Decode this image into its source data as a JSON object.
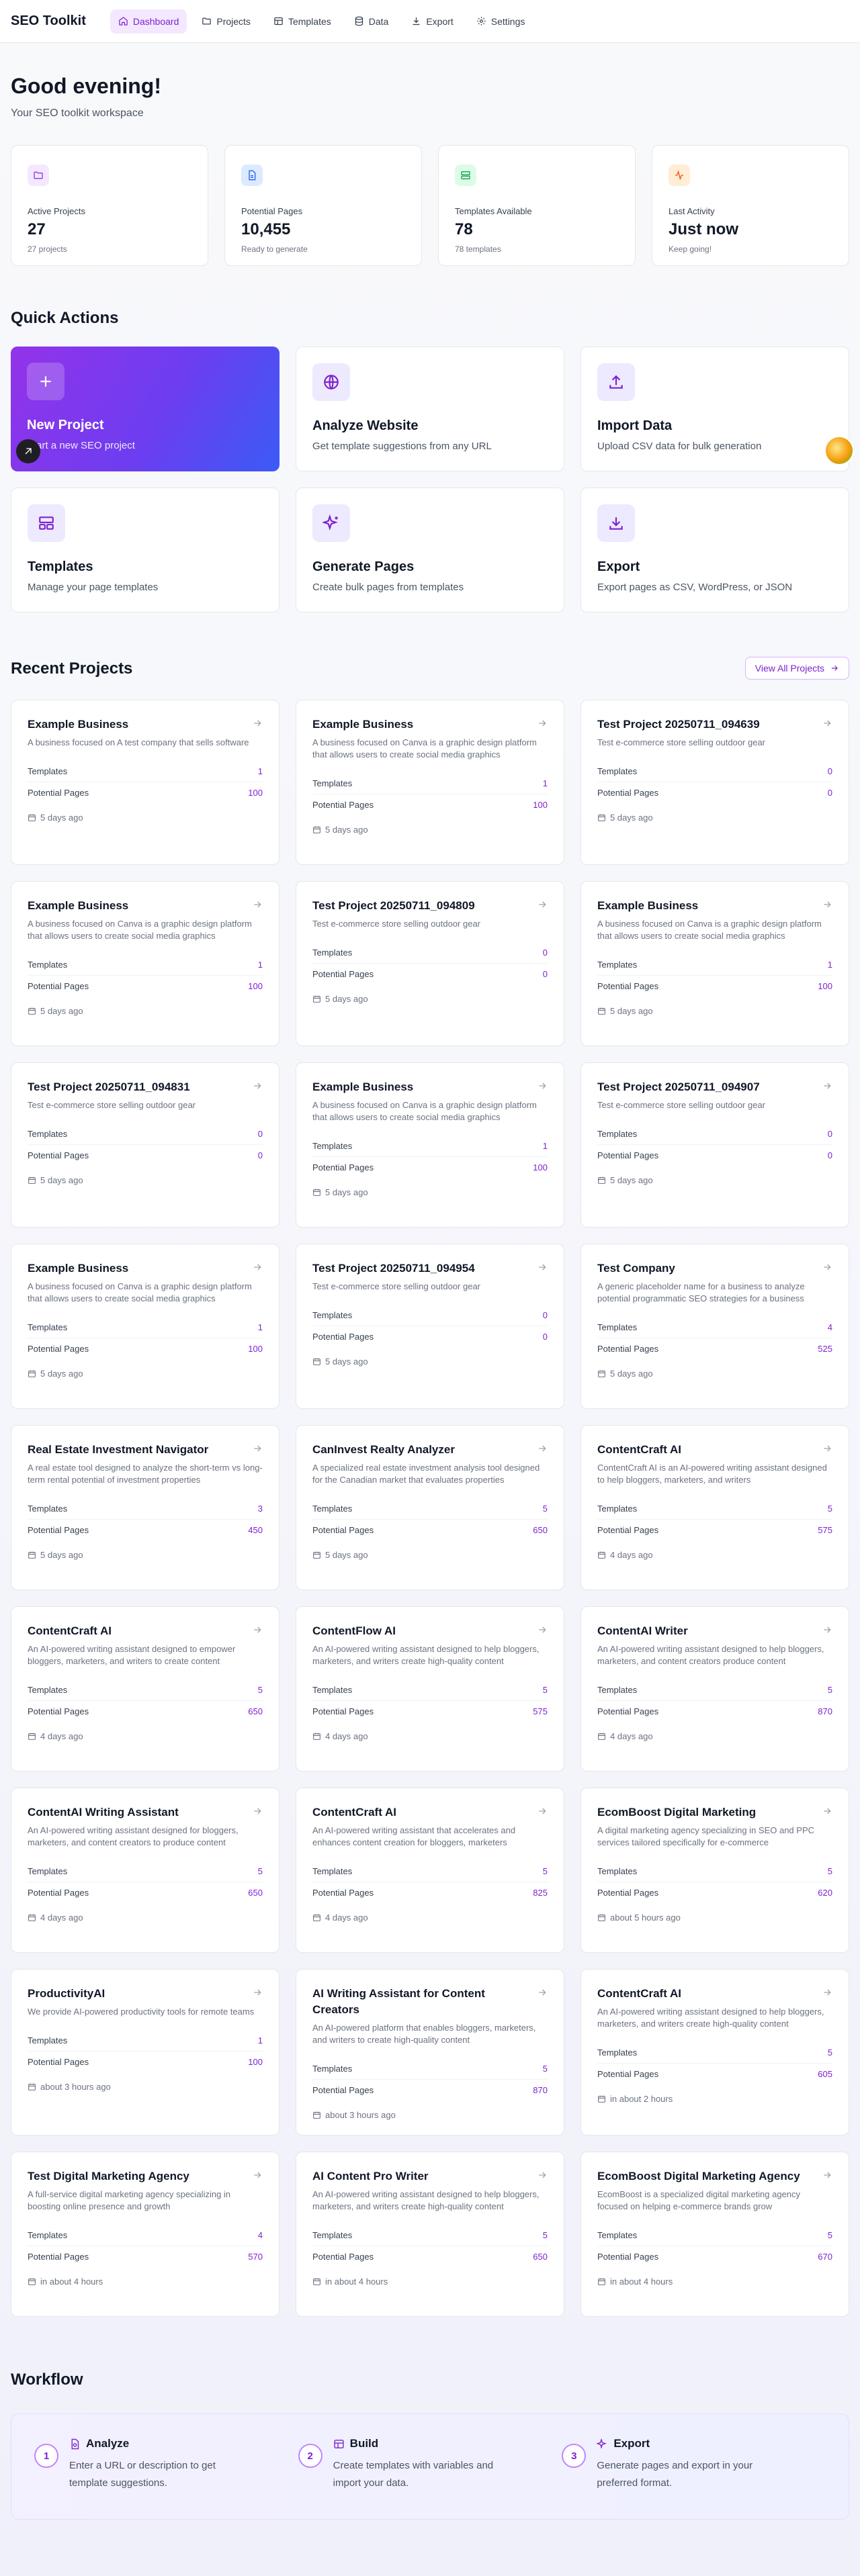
{
  "header": {
    "brand": "SEO Toolkit",
    "nav": [
      {
        "label": "Dashboard",
        "icon": "home-icon"
      },
      {
        "label": "Projects",
        "icon": "folder-icon"
      },
      {
        "label": "Templates",
        "icon": "layout-icon"
      },
      {
        "label": "Data",
        "icon": "database-icon"
      },
      {
        "label": "Export",
        "icon": "download-icon"
      },
      {
        "label": "Settings",
        "icon": "gear-icon"
      }
    ]
  },
  "greeting": {
    "title": "Good evening!",
    "subtitle": "Your SEO toolkit workspace"
  },
  "stats": [
    {
      "label": "Active Projects",
      "value": "27",
      "sub": "27 projects",
      "icon": "folder-icon",
      "color": "#9333ea"
    },
    {
      "label": "Potential Pages",
      "value": "10,455",
      "sub": "Ready to generate",
      "icon": "file-icon",
      "color": "#2563eb"
    },
    {
      "label": "Templates Available",
      "value": "78",
      "sub": "78 templates",
      "icon": "layout-icon",
      "color": "#16a34a"
    },
    {
      "label": "Last Activity",
      "value": "Just now",
      "sub": "Keep going!",
      "icon": "activity-icon",
      "color": "#ea580c"
    }
  ],
  "quick_actions": {
    "title": "Quick Actions",
    "items": [
      {
        "title": "New Project",
        "desc": "Start a new SEO project",
        "icon": "plus-icon"
      },
      {
        "title": "Analyze Website",
        "desc": "Get template suggestions from any URL",
        "icon": "globe-icon"
      },
      {
        "title": "Import Data",
        "desc": "Upload CSV data for bulk generation",
        "icon": "upload-icon"
      },
      {
        "title": "Templates",
        "desc": "Manage your page templates",
        "icon": "layout-icon"
      },
      {
        "title": "Generate Pages",
        "desc": "Create bulk pages from templates",
        "icon": "sparkles-icon"
      },
      {
        "title": "Export",
        "desc": "Export pages as CSV, WordPress, or JSON",
        "icon": "download-icon"
      }
    ]
  },
  "recent": {
    "title": "Recent Projects",
    "view_all": "View All Projects",
    "templates_label": "Templates",
    "pages_label": "Potential Pages",
    "projects": [
      {
        "name": "Example Business",
        "desc": "A business focused on A test company that sells software",
        "templates": "1",
        "pages": "100",
        "time": "5 days ago"
      },
      {
        "name": "Example Business",
        "desc": "A business focused on Canva is a graphic design platform that allows users to create social media graphics",
        "templates": "1",
        "pages": "100",
        "time": "5 days ago"
      },
      {
        "name": "Test Project 20250711_094639",
        "desc": "Test e-commerce store selling outdoor gear",
        "templates": "0",
        "pages": "0",
        "time": "5 days ago"
      },
      {
        "name": "Example Business",
        "desc": "A business focused on Canva is a graphic design platform that allows users to create social media graphics",
        "templates": "1",
        "pages": "100",
        "time": "5 days ago"
      },
      {
        "name": "Test Project 20250711_094809",
        "desc": "Test e-commerce store selling outdoor gear",
        "templates": "0",
        "pages": "0",
        "time": "5 days ago"
      },
      {
        "name": "Example Business",
        "desc": "A business focused on Canva is a graphic design platform that allows users to create social media graphics",
        "templates": "1",
        "pages": "100",
        "time": "5 days ago"
      },
      {
        "name": "Test Project 20250711_094831",
        "desc": "Test e-commerce store selling outdoor gear",
        "templates": "0",
        "pages": "0",
        "time": "5 days ago"
      },
      {
        "name": "Example Business",
        "desc": "A business focused on Canva is a graphic design platform that allows users to create social media graphics",
        "templates": "1",
        "pages": "100",
        "time": "5 days ago"
      },
      {
        "name": "Test Project 20250711_094907",
        "desc": "Test e-commerce store selling outdoor gear",
        "templates": "0",
        "pages": "0",
        "time": "5 days ago"
      },
      {
        "name": "Example Business",
        "desc": "A business focused on Canva is a graphic design platform that allows users to create social media graphics",
        "templates": "1",
        "pages": "100",
        "time": "5 days ago"
      },
      {
        "name": "Test Project 20250711_094954",
        "desc": "Test e-commerce store selling outdoor gear",
        "templates": "0",
        "pages": "0",
        "time": "5 days ago"
      },
      {
        "name": "Test Company",
        "desc": "A generic placeholder name for a business to analyze potential programmatic SEO strategies for a business",
        "templates": "4",
        "pages": "525",
        "time": "5 days ago"
      },
      {
        "name": "Real Estate Investment Navigator",
        "desc": "A real estate tool designed to analyze the short-term vs long-term rental potential of investment properties",
        "templates": "3",
        "pages": "450",
        "time": "5 days ago"
      },
      {
        "name": "CanInvest Realty Analyzer",
        "desc": "A specialized real estate investment analysis tool designed for the Canadian market that evaluates properties",
        "templates": "5",
        "pages": "650",
        "time": "5 days ago"
      },
      {
        "name": "ContentCraft AI",
        "desc": "ContentCraft AI is an AI-powered writing assistant designed to help bloggers, marketers, and writers",
        "templates": "5",
        "pages": "575",
        "time": "4 days ago"
      },
      {
        "name": "ContentCraft AI",
        "desc": "An AI-powered writing assistant designed to empower bloggers, marketers, and writers to create content",
        "templates": "5",
        "pages": "650",
        "time": "4 days ago"
      },
      {
        "name": "ContentFlow AI",
        "desc": "An AI-powered writing assistant designed to help bloggers, marketers, and writers create high-quality content",
        "templates": "5",
        "pages": "575",
        "time": "4 days ago"
      },
      {
        "name": "ContentAI Writer",
        "desc": "An AI-powered writing assistant designed to help bloggers, marketers, and content creators produce content",
        "templates": "5",
        "pages": "870",
        "time": "4 days ago"
      },
      {
        "name": "ContentAI Writing Assistant",
        "desc": "An AI-powered writing assistant designed for bloggers, marketers, and content creators to produce content",
        "templates": "5",
        "pages": "650",
        "time": "4 days ago"
      },
      {
        "name": "ContentCraft AI",
        "desc": "An AI-powered writing assistant that accelerates and enhances content creation for bloggers, marketers",
        "templates": "5",
        "pages": "825",
        "time": "4 days ago"
      },
      {
        "name": "EcomBoost Digital Marketing",
        "desc": "A digital marketing agency specializing in SEO and PPC services tailored specifically for e-commerce",
        "templates": "5",
        "pages": "620",
        "time": "about 5 hours ago"
      },
      {
        "name": "ProductivityAI",
        "desc": "We provide AI-powered productivity tools for remote teams",
        "templates": "1",
        "pages": "100",
        "time": "about 3 hours ago"
      },
      {
        "name": "AI Writing Assistant for Content Creators",
        "desc": "An AI-powered platform that enables bloggers, marketers, and writers to create high-quality content",
        "templates": "5",
        "pages": "870",
        "time": "about 3 hours ago"
      },
      {
        "name": "ContentCraft AI",
        "desc": "An AI-powered writing assistant designed to help bloggers, marketers, and writers create high-quality content",
        "templates": "5",
        "pages": "605",
        "time": "in about 2 hours"
      },
      {
        "name": "Test Digital Marketing Agency",
        "desc": "A full-service digital marketing agency specializing in boosting online presence and growth",
        "templates": "4",
        "pages": "570",
        "time": "in about 4 hours"
      },
      {
        "name": "AI Content Pro Writer",
        "desc": "An AI-powered writing assistant designed to help bloggers, marketers, and writers create high-quality content",
        "templates": "5",
        "pages": "650",
        "time": "in about 4 hours"
      },
      {
        "name": "EcomBoost Digital Marketing Agency",
        "desc": "EcomBoost is a specialized digital marketing agency focused on helping e-commerce brands grow",
        "templates": "5",
        "pages": "670",
        "time": "in about 4 hours"
      }
    ]
  },
  "workflow": {
    "title": "Workflow",
    "steps": [
      {
        "num": "1",
        "title": "Analyze",
        "desc": "Enter a URL or description to get template suggestions.",
        "icon": "file-search-icon"
      },
      {
        "num": "2",
        "title": "Build",
        "desc": "Create templates with variables and import your data.",
        "icon": "layout-icon"
      },
      {
        "num": "3",
        "title": "Export",
        "desc": "Generate pages and export in your preferred format.",
        "icon": "sparkles-icon"
      }
    ]
  },
  "colors": {
    "accent": "#7e22ce",
    "primary_gradient_start": "#9333ea",
    "primary_gradient_end": "#3b5bf6"
  }
}
